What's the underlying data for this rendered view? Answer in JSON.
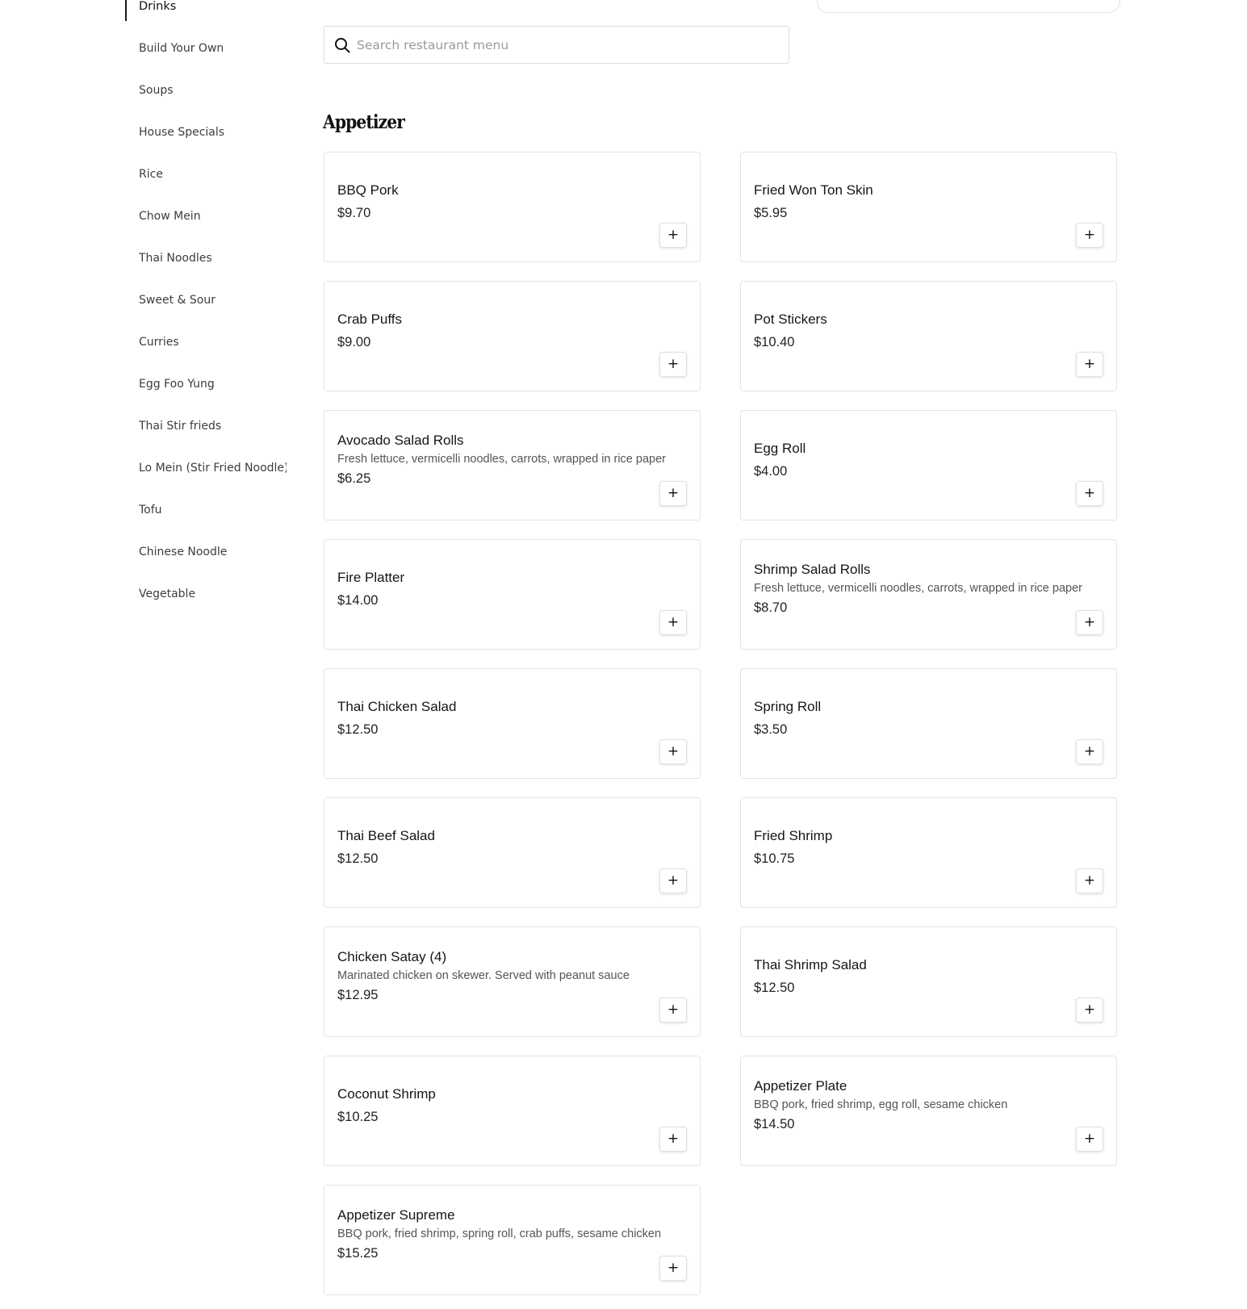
{
  "sidebar": {
    "items": [
      {
        "label": "Drinks",
        "active": true
      },
      {
        "label": "Build Your Own"
      },
      {
        "label": "Soups"
      },
      {
        "label": "House Specials"
      },
      {
        "label": "Rice"
      },
      {
        "label": "Chow Mein"
      },
      {
        "label": "Thai Noodles"
      },
      {
        "label": "Sweet & Sour"
      },
      {
        "label": "Curries"
      },
      {
        "label": "Egg Foo Yung"
      },
      {
        "label": "Thai Stir frieds"
      },
      {
        "label": "Lo Mein (Stir Fried Noodle)"
      },
      {
        "label": "Tofu"
      },
      {
        "label": "Chinese Noodle"
      },
      {
        "label": "Vegetable"
      }
    ]
  },
  "search": {
    "placeholder": "Search restaurant menu",
    "value": "",
    "icon": "search-icon"
  },
  "section": {
    "title": "Appetizer"
  },
  "add_button_label": "+",
  "items": [
    {
      "name": "BBQ Pork",
      "price": "$9.70",
      "desc": ""
    },
    {
      "name": "Fried Won Ton Skin",
      "price": "$5.95",
      "desc": ""
    },
    {
      "name": "Crab Puffs",
      "price": "$9.00",
      "desc": ""
    },
    {
      "name": "Pot Stickers",
      "price": "$10.40",
      "desc": ""
    },
    {
      "name": "Avocado Salad Rolls",
      "price": "$6.25",
      "desc": "Fresh lettuce, vermicelli noodles, carrots, wrapped in rice paper"
    },
    {
      "name": "Egg Roll",
      "price": "$4.00",
      "desc": ""
    },
    {
      "name": "Fire Platter",
      "price": "$14.00",
      "desc": ""
    },
    {
      "name": "Shrimp Salad Rolls",
      "price": "$8.70",
      "desc": "Fresh lettuce, vermicelli noodles, carrots, wrapped in rice paper"
    },
    {
      "name": "Thai Chicken Salad",
      "price": "$12.50",
      "desc": ""
    },
    {
      "name": "Spring Roll",
      "price": "$3.50",
      "desc": ""
    },
    {
      "name": "Thai Beef Salad",
      "price": "$12.50",
      "desc": ""
    },
    {
      "name": "Fried Shrimp",
      "price": "$10.75",
      "desc": ""
    },
    {
      "name": "Chicken Satay (4)",
      "price": "$12.95",
      "desc": "Marinated chicken on skewer. Served with peanut sauce"
    },
    {
      "name": "Thai Shrimp Salad",
      "price": "$12.50",
      "desc": ""
    },
    {
      "name": "Coconut Shrimp",
      "price": "$10.25",
      "desc": ""
    },
    {
      "name": "Appetizer Plate",
      "price": "$14.50",
      "desc": "BBQ pork, fried shrimp, egg roll, sesame chicken"
    },
    {
      "name": "Appetizer Supreme",
      "price": "$15.25",
      "desc": "BBQ pork, fried shrimp, spring roll, crab puffs, sesame chicken"
    }
  ]
}
